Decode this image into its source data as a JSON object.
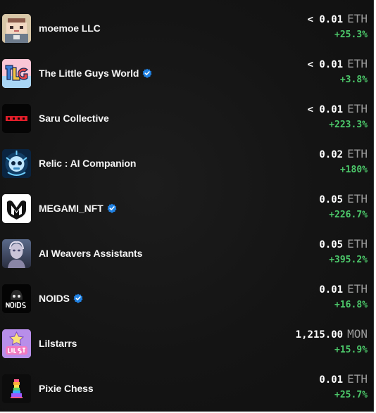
{
  "collections": [
    {
      "name": "moemoe LLC",
      "verified": false,
      "price": "< 0.01",
      "unit": "ETH",
      "change": "+25.3%",
      "thumb": "pixel-character"
    },
    {
      "name": "The Little Guys World",
      "verified": true,
      "price": "< 0.01",
      "unit": "ETH",
      "change": "+3.8%",
      "thumb": "tlg-logo"
    },
    {
      "name": "Saru Collective",
      "verified": false,
      "price": "< 0.01",
      "unit": "ETH",
      "change": "+223.3%",
      "thumb": "saru-logo"
    },
    {
      "name": "Relic : AI Companion",
      "verified": false,
      "price": "0.02",
      "unit": "ETH",
      "change": "+180%",
      "thumb": "blue-robot"
    },
    {
      "name": "MEGAMI_NFT",
      "verified": true,
      "price": "0.05",
      "unit": "ETH",
      "change": "+226.7%",
      "thumb": "megami-logo"
    },
    {
      "name": "AI Weavers Assistants",
      "verified": false,
      "price": "0.05",
      "unit": "ETH",
      "change": "+395.2%",
      "thumb": "ai-portrait"
    },
    {
      "name": "NOIDS",
      "verified": true,
      "price": "0.01",
      "unit": "ETH",
      "change": "+16.8%",
      "thumb": "noids-logo"
    },
    {
      "name": "Lilstarrs",
      "verified": false,
      "price": "1,215.00",
      "unit": "MON",
      "change": "+15.9%",
      "thumb": "lilstarrs-logo"
    },
    {
      "name": "Pixie Chess",
      "verified": false,
      "price": "0.01",
      "unit": "ETH",
      "change": "+25.7%",
      "thumb": "chess-piece"
    }
  ],
  "colors": {
    "background": "#121212",
    "change_positive": "#4cc86a",
    "verified_badge": "#2081e2",
    "unit_text": "#9a9a9a"
  }
}
